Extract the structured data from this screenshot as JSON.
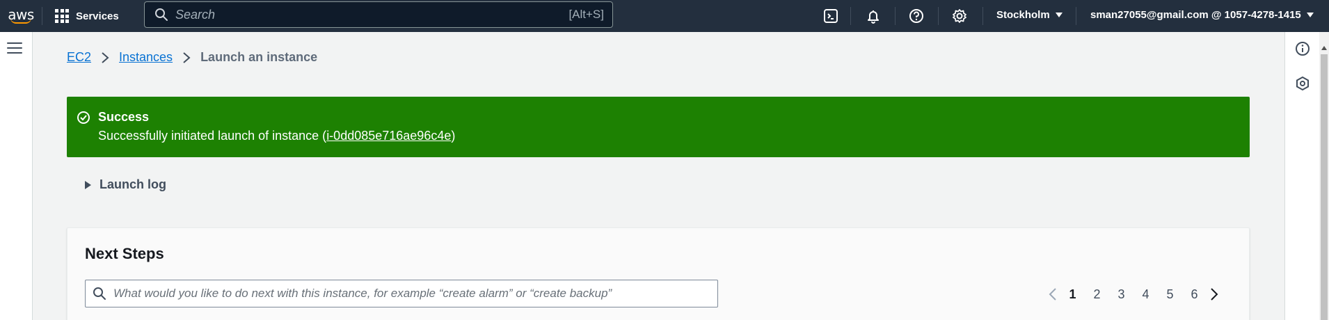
{
  "topnav": {
    "logo_text": "aws",
    "services_label": "Services",
    "search_placeholder": "Search",
    "search_shortcut": "[Alt+S]",
    "region": "Stockholm",
    "account": "sman27055@gmail.com @ 1057-4278-1415"
  },
  "breadcrumb": {
    "items": [
      "EC2",
      "Instances"
    ],
    "current": "Launch an instance"
  },
  "flash": {
    "type": "success",
    "title": "Success",
    "message_prefix": "Successfully initiated launch of instance (",
    "instance_id": "i-0dd085e716ae96c4e",
    "message_suffix": ")",
    "color": "#1d8102"
  },
  "launch_log": {
    "label": "Launch log"
  },
  "next_steps": {
    "title": "Next Steps",
    "search_placeholder": "What would you like to do next with this instance, for example “create alarm” or “create backup”",
    "pages": [
      "1",
      "2",
      "3",
      "4",
      "5",
      "6"
    ],
    "current_page": "1"
  },
  "colors": {
    "nav_bg": "#232f3e",
    "accent": "#ff9900",
    "link": "#0972d3"
  }
}
